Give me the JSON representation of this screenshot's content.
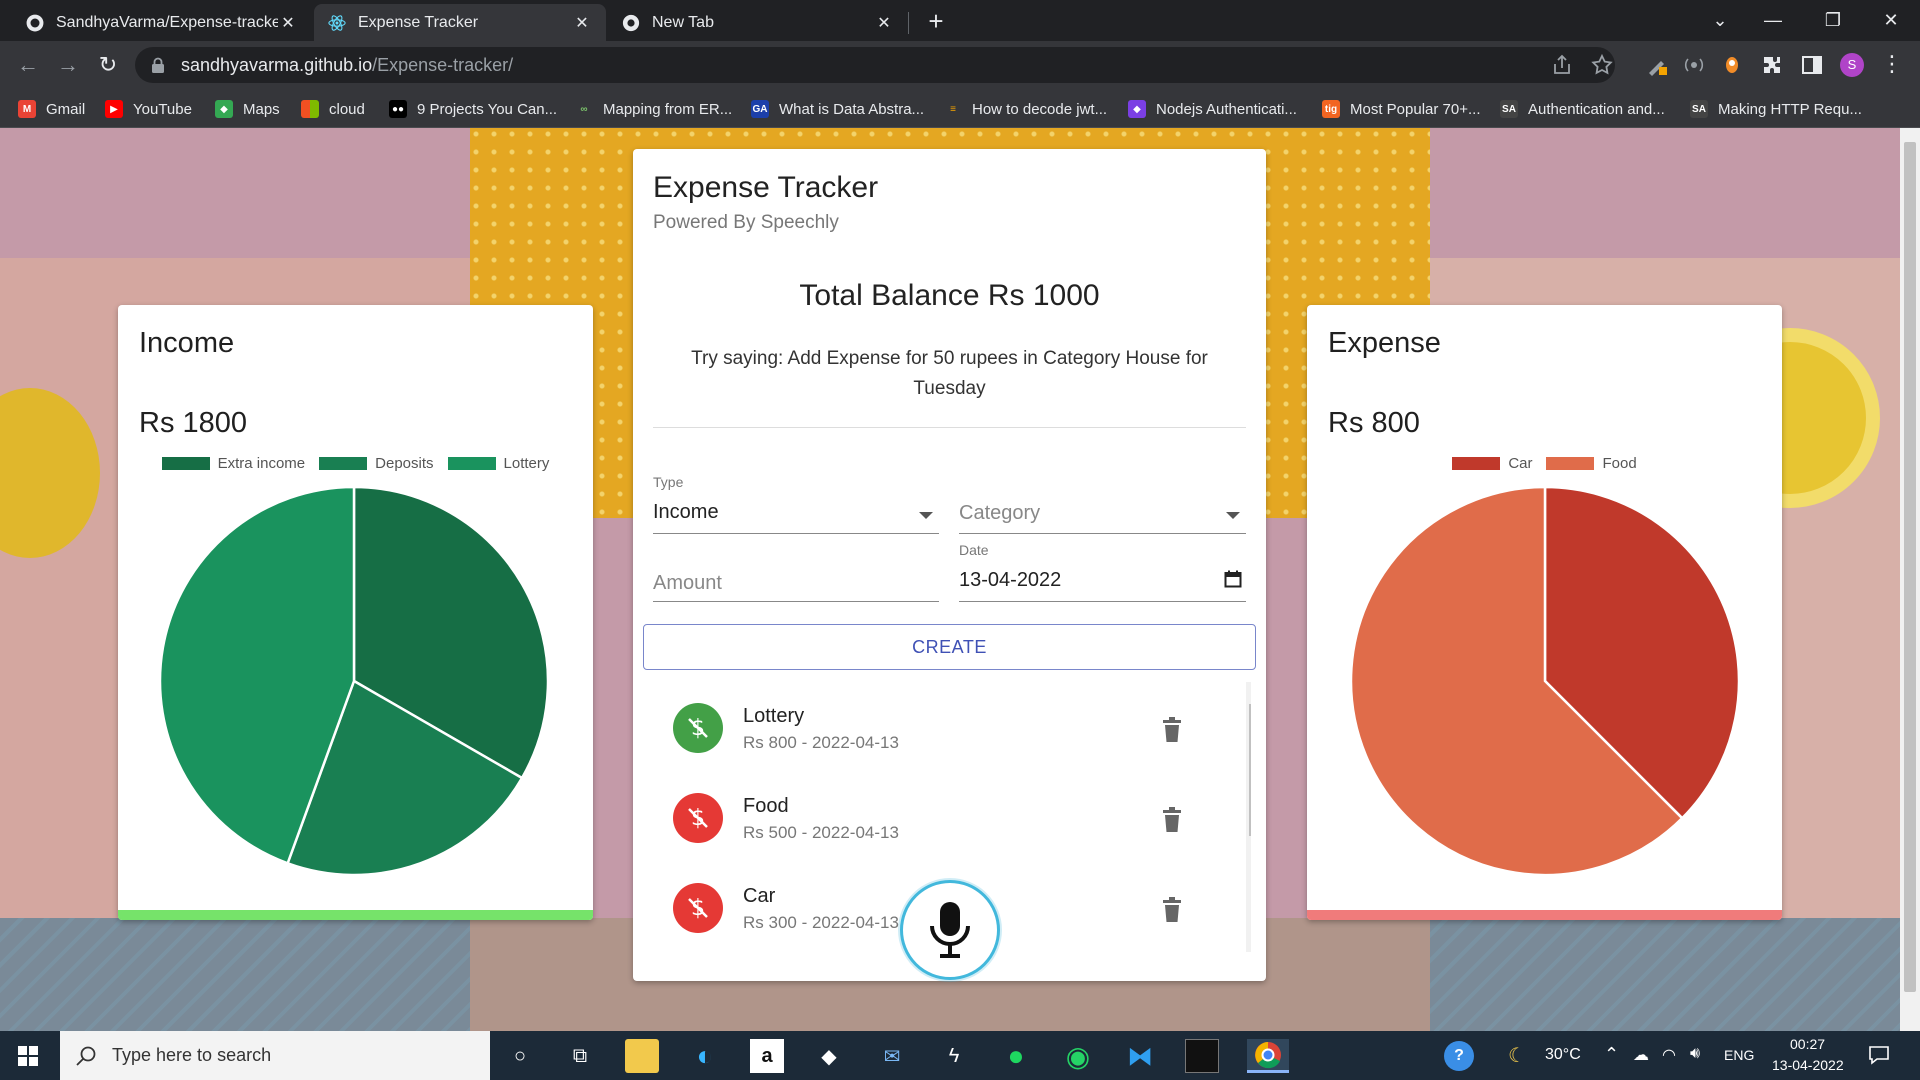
{
  "browser": {
    "tabs": [
      {
        "title": "SandhyaVarma/Expense-tracker:",
        "active": false
      },
      {
        "title": "Expense Tracker",
        "active": true
      },
      {
        "title": "New Tab",
        "active": false
      }
    ],
    "url_host": "sandhyavarma.github.io",
    "url_path": "/Expense-tracker/",
    "profile_initial": "S",
    "bookmarks": [
      "Gmail",
      "YouTube",
      "Maps",
      "cloud",
      "9 Projects You Can...",
      "Mapping from ER...",
      "What is Data Abstra...",
      "How to decode jwt...",
      "Nodejs Authenticati...",
      "Most Popular 70+...",
      "Authentication and...",
      "Making HTTP Requ..."
    ]
  },
  "income": {
    "title": "Income",
    "amount": "Rs 1800",
    "accent": "#76e36a",
    "legend": [
      {
        "label": "Extra income",
        "color": "#166e45"
      },
      {
        "label": "Deposits",
        "color": "#197f52"
      },
      {
        "label": "Lottery",
        "color": "#1a935e"
      }
    ]
  },
  "expense": {
    "title": "Expense",
    "amount": "Rs 800",
    "accent": "#f07b7b",
    "legend": [
      {
        "label": "Car",
        "color": "#c0392b"
      },
      {
        "label": "Food",
        "color": "#e06c4a"
      }
    ]
  },
  "chart_data": [
    {
      "type": "pie",
      "categories": [
        "Extra income",
        "Deposits",
        "Lottery"
      ],
      "values": [
        600,
        400,
        800
      ],
      "colors": [
        "#166e45",
        "#197f52",
        "#1a935e"
      ]
    },
    {
      "type": "pie",
      "categories": [
        "Car",
        "Food"
      ],
      "values": [
        300,
        500
      ],
      "colors": [
        "#c0392b",
        "#e06c4a"
      ]
    }
  ],
  "tracker": {
    "title": "Expense Tracker",
    "subtitle": "Powered By Speechly",
    "balance": "Total Balance Rs 1000",
    "hint": "Try saying: Add Expense for 50 rupees in Category House for Tuesday",
    "type_label": "Type",
    "type_value": "Income",
    "category_placeholder": "Category",
    "amount_placeholder": "Amount",
    "date_label": "Date",
    "date_value": "13-04-2022",
    "create_label": "CREATE",
    "transactions": [
      {
        "name": "Lottery",
        "meta": "Rs 800 - 2022-04-13",
        "kind": "income",
        "color": "#43a047"
      },
      {
        "name": "Food",
        "meta": "Rs 500 - 2022-04-13",
        "kind": "expense",
        "color": "#e53935"
      },
      {
        "name": "Car",
        "meta": "Rs 300 - 2022-04-13",
        "kind": "expense",
        "color": "#e53935"
      }
    ]
  },
  "taskbar": {
    "search_placeholder": "Type here to search",
    "temperature": "30°C",
    "language": "ENG",
    "time": "00:27",
    "date": "13-04-2022"
  }
}
